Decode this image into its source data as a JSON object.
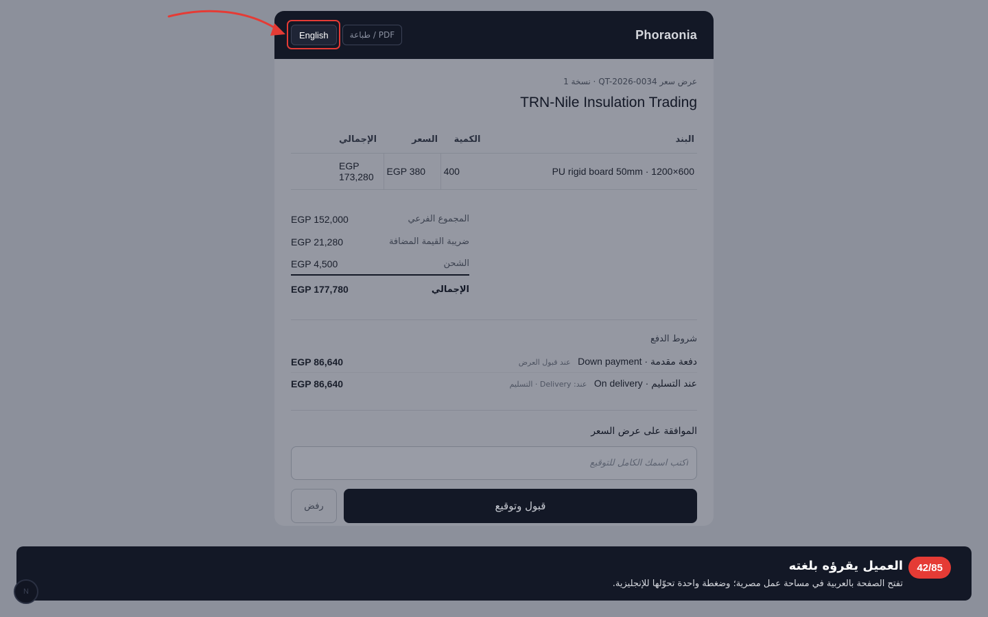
{
  "header": {
    "brand": "Phoraonia",
    "lang_button": "English",
    "print_button": "طباعة / PDF"
  },
  "quote": {
    "ref": "عرض سعر QT-2026-0034 · نسخة 1",
    "client": "TRN-Nile Insulation Trading"
  },
  "items_table": {
    "headers": {
      "item": "البند",
      "qty": "الكمية",
      "price": "السعر",
      "total": "الإجمالي"
    },
    "rows": [
      {
        "item": "PU rigid board 50mm · 1200×600",
        "qty": "400",
        "price": "EGP 380",
        "total": "EGP 173,280"
      }
    ]
  },
  "totals": {
    "subtotal_label": "المجموع الفرعي",
    "subtotal": "EGP 152,000",
    "vat_label": "ضريبة القيمة المضافة",
    "vat": "EGP 21,280",
    "shipping_label": "الشحن",
    "shipping": "EGP 4,500",
    "grand_label": "الإجمالي",
    "grand": "EGP 177,780"
  },
  "payment": {
    "title": "شروط الدفع",
    "rows": [
      {
        "label": "دفعة مقدمة · Down payment",
        "note": "عند قبول العرض",
        "amount": "EGP 86,640"
      },
      {
        "label": "عند التسليم · On delivery",
        "note": "عند: Delivery · التسليم",
        "amount": "EGP 86,640"
      }
    ]
  },
  "approval": {
    "title": "الموافقة على عرض السعر",
    "placeholder": "اكتب اسمك الكامل للتوقيع",
    "accept": "قبول وتوقيع",
    "reject": "رفض"
  },
  "banner": {
    "step": "42/85",
    "title": "العميل يقرؤه بلغته",
    "subtitle": "تفتح الصفحة بالعربية في مساحة عمل مصرية؛ وضغطة واحدة تحوّلها للإنجليزية."
  },
  "avatar": {
    "initial": "N"
  },
  "colors": {
    "accent_red": "#e53b35",
    "dark": "#131826"
  }
}
